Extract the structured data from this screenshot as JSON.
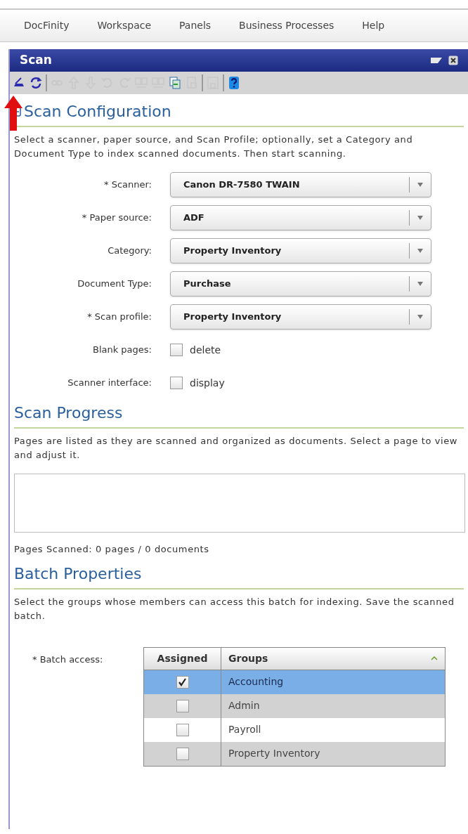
{
  "menu": [
    "DocFinity",
    "Workspace",
    "Panels",
    "Business Processes",
    "Help"
  ],
  "panel": {
    "title": "Scan"
  },
  "toolbar": [
    {
      "kind": "scanner",
      "disabled": false
    },
    {
      "kind": "refresh",
      "disabled": false
    },
    {
      "kind": "sep"
    },
    {
      "kind": "link",
      "disabled": true
    },
    {
      "kind": "up",
      "disabled": true
    },
    {
      "kind": "down",
      "disabled": true
    },
    {
      "kind": "rotate-left",
      "disabled": true
    },
    {
      "kind": "rotate-right",
      "disabled": true
    },
    {
      "kind": "split",
      "disabled": true
    },
    {
      "kind": "merge",
      "disabled": true
    },
    {
      "kind": "copy",
      "disabled": false
    },
    {
      "kind": "page",
      "disabled": true
    },
    {
      "kind": "sep"
    },
    {
      "kind": "save",
      "disabled": true
    },
    {
      "kind": "sep"
    },
    {
      "kind": "help",
      "disabled": false
    }
  ],
  "scan_configuration": {
    "title": "Scan Configuration",
    "expanded": true,
    "description": "Select a scanner, paper source, and Scan Profile; optionally, set a Category and Document Type to index scanned documents. Then start scanning.",
    "fields": [
      {
        "kind": "select",
        "label": "* Scanner:",
        "value": "Canon DR-7580 TWAIN"
      },
      {
        "kind": "select",
        "label": "* Paper source:",
        "value": "ADF"
      },
      {
        "kind": "select",
        "label": "Category:",
        "value": "Property Inventory"
      },
      {
        "kind": "select",
        "label": "Document Type:",
        "value": "Purchase"
      },
      {
        "kind": "select",
        "label": "* Scan profile:",
        "value": "Property Inventory"
      },
      {
        "kind": "checkbox",
        "label": "Blank pages:",
        "value": "delete",
        "checked": false
      },
      {
        "kind": "checkbox",
        "label": "Scanner interface:",
        "value": "display",
        "checked": false
      }
    ]
  },
  "scan_progress": {
    "title": "Scan Progress",
    "description": "Pages are listed as they are scanned and organized as documents. Select a page to view and adjust it.",
    "pages_scanned": "Pages Scanned: 0 pages / 0 documents"
  },
  "batch_properties": {
    "title": "Batch Properties",
    "description": "Select the groups whose members can access this batch for indexing. Save the scanned batch.",
    "label": "* Batch access:",
    "columns": [
      "Assigned",
      "Groups"
    ],
    "rows": [
      {
        "group": "Accounting",
        "checked": true,
        "selected": true
      },
      {
        "group": "Admin",
        "checked": false,
        "selected": false
      },
      {
        "group": "Payroll",
        "checked": false,
        "selected": false
      },
      {
        "group": "Property Inventory",
        "checked": false,
        "selected": false
      }
    ]
  }
}
